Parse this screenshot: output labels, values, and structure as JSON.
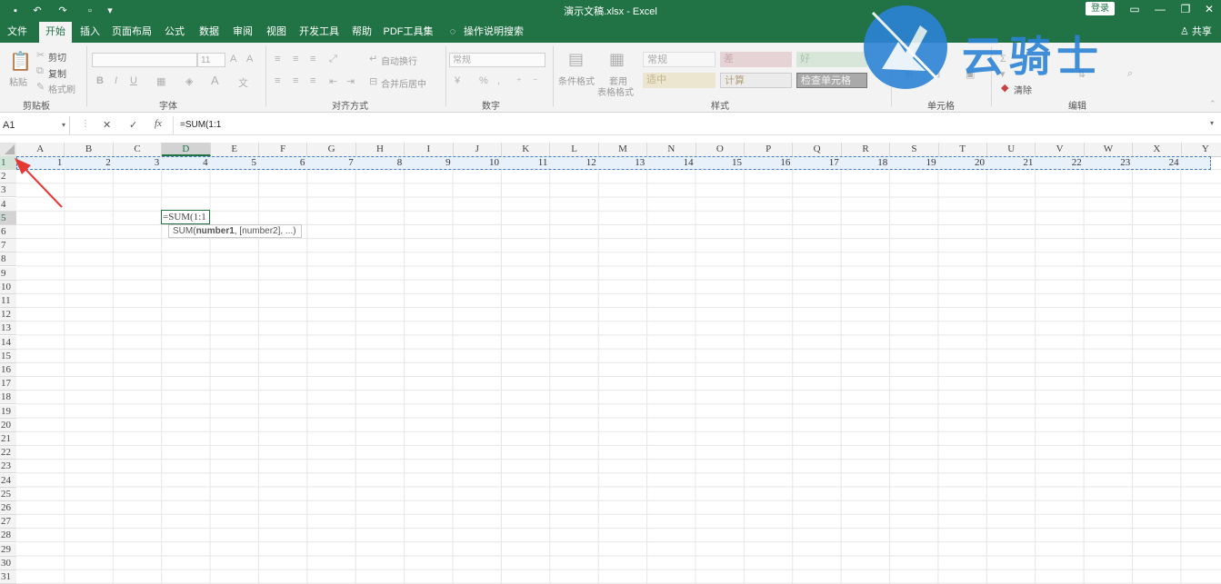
{
  "titlebar": {
    "title": "演示文稿.xlsx  -  Excel",
    "login": "登录",
    "qa_icons": [
      "save-icon",
      "undo-icon",
      "redo-icon",
      "touch-mode-icon",
      "customize-icon"
    ]
  },
  "tabs": [
    "文件",
    "开始",
    "插入",
    "页面布局",
    "公式",
    "数据",
    "审阅",
    "视图",
    "开发工具",
    "帮助",
    "PDF工具集",
    "操作说明搜索"
  ],
  "active_tab": "开始",
  "share": "共享",
  "ribbon": {
    "clipboard": {
      "paste": "粘贴",
      "cut": "剪切",
      "copy": "复制",
      "format_painter": "格式刷",
      "label": "剪贴板"
    },
    "font": {
      "size": "11",
      "label": "字体",
      "bold": "B",
      "italic": "I",
      "underline": "U"
    },
    "alignment": {
      "wrap": "自动换行",
      "merge": "合并后居中",
      "label": "对齐方式"
    },
    "number": {
      "format": "常规",
      "percent": "%",
      "label": "数字"
    },
    "styles": {
      "conditional": "条件格式",
      "table_format_1": "套用",
      "table_format_2": "表格格式",
      "cells": [
        "常规",
        "差",
        "好",
        "适中",
        "计算",
        "检查单元格"
      ],
      "label": "样式"
    },
    "cells_group": {
      "label": "单元格"
    },
    "editing": {
      "clear": "清除",
      "label": "编辑"
    }
  },
  "watermark": {
    "text": "云骑士"
  },
  "formula_bar": {
    "name_box": "A1",
    "cancel": "✕",
    "enter": "✓",
    "fx": "fx",
    "formula": "=SUM(1:1"
  },
  "sheet": {
    "columns": [
      "A",
      "B",
      "C",
      "D",
      "E",
      "F",
      "G",
      "H",
      "I",
      "J",
      "K",
      "L",
      "M",
      "N",
      "O",
      "P",
      "Q",
      "R",
      "S",
      "T",
      "U",
      "V",
      "W",
      "X",
      "Y"
    ],
    "selected_column": "D",
    "rows": [
      "1",
      "2",
      "3",
      "4",
      "5",
      "6",
      "7",
      "8",
      "9",
      "10",
      "11",
      "12",
      "13",
      "14",
      "15",
      "16",
      "17",
      "18",
      "19",
      "20",
      "21",
      "22",
      "23",
      "24",
      "25",
      "26",
      "27",
      "28",
      "29",
      "30",
      "31"
    ],
    "row1_values": [
      "1",
      "2",
      "3",
      "4",
      "5",
      "6",
      "7",
      "8",
      "9",
      "10",
      "11",
      "12",
      "13",
      "14",
      "15",
      "16",
      "17",
      "18",
      "19",
      "20",
      "21",
      "22",
      "23",
      "24"
    ],
    "edit_cell_text": "=SUM(1:1",
    "tooltip_func": "SUM(",
    "tooltip_arg1": "number1",
    "tooltip_rest": ", [number2], ...)"
  },
  "colors": {
    "excel_green": "#217346",
    "annotation_red": "#e53935",
    "watermark_blue": "#2d83d6"
  }
}
